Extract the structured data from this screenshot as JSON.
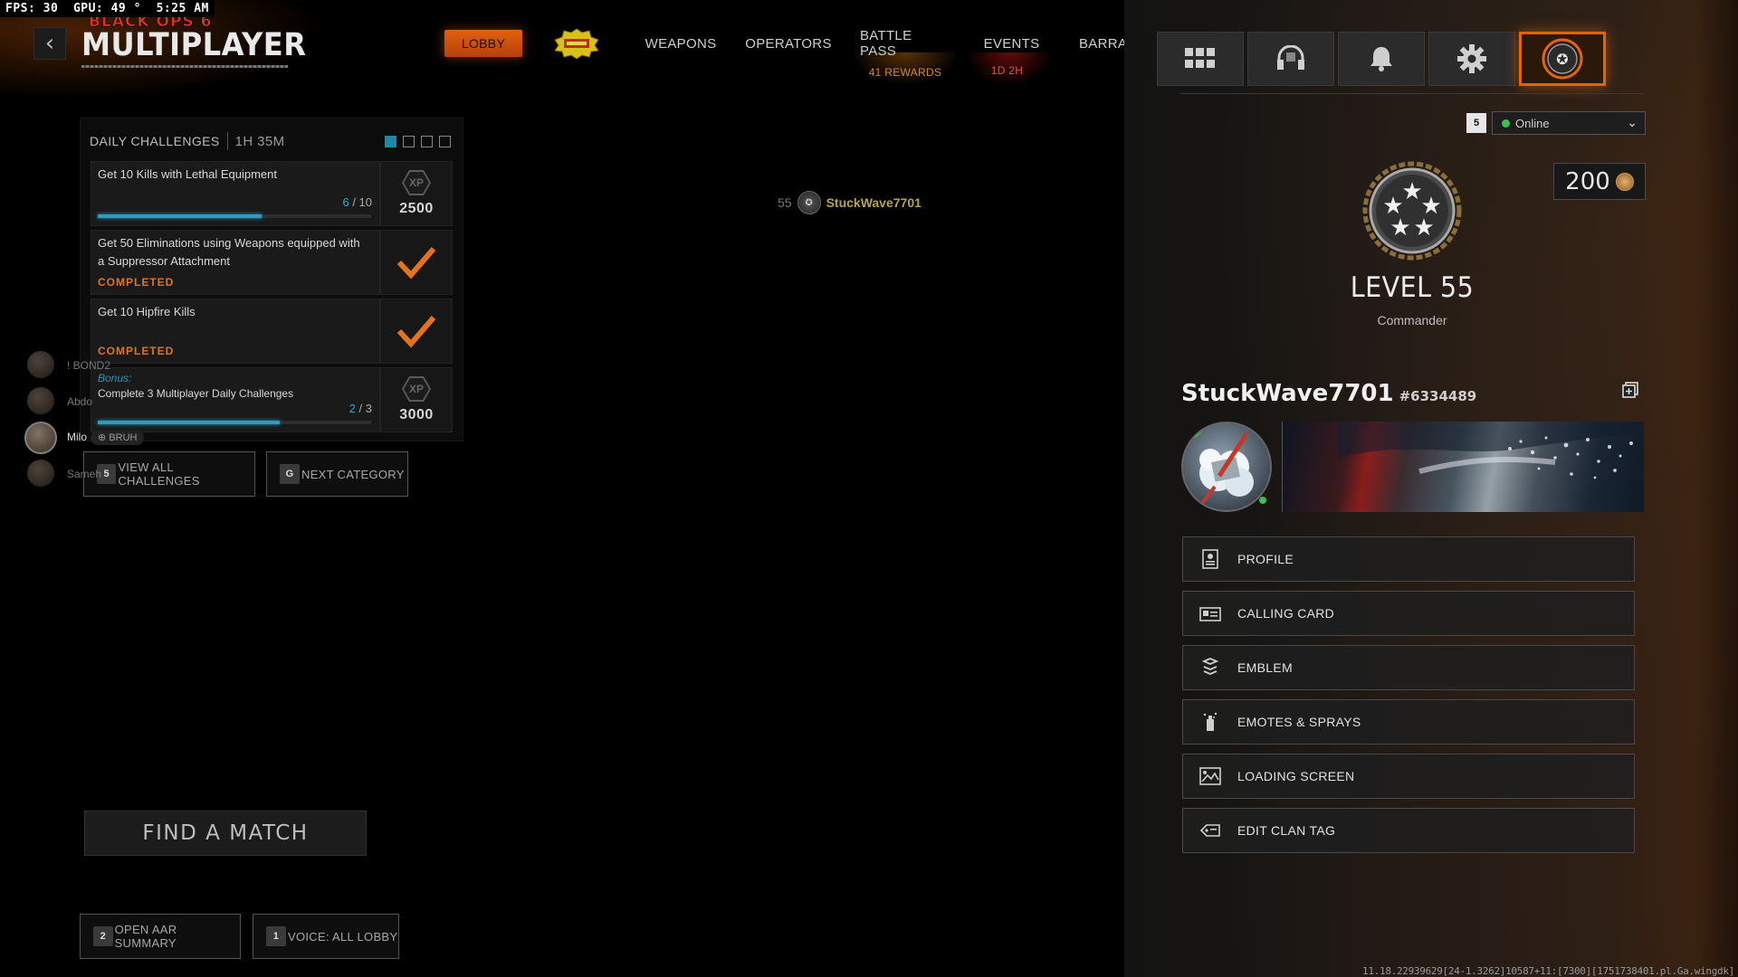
{
  "hud": {
    "fps_label": "FPS:",
    "fps_value": "30",
    "gpu_label": "GPU:",
    "gpu_value": "49 °",
    "clock": "5:25 AM"
  },
  "brand": {
    "top": "BLACK OPS 6",
    "main": "MULTIPLAYER"
  },
  "nav": {
    "lobby": "LOBBY",
    "weapons": "WEAPONS",
    "operators": "OPERATORS",
    "battle_pass": "BATTLE PASS",
    "battle_pass_sub": "41 REWARDS",
    "events": "EVENTS",
    "events_sub": "1D 2H",
    "barracks": "BARRAC"
  },
  "challenges": {
    "header": "DAILY CHALLENGES",
    "timer": "1H 35M",
    "items": [
      {
        "title": "Get 10 Kills with Lethal Equipment",
        "progress_current": "6",
        "progress_total": "/ 10",
        "progress_fraction": 0.6,
        "xp_label": "XP",
        "xp": "2500"
      },
      {
        "title": "Get 50 Eliminations using Weapons equipped with a Suppressor Attachment",
        "status": "COMPLETED"
      },
      {
        "title": "Get 10 Hipfire Kills",
        "status": "COMPLETED"
      }
    ],
    "bonus": {
      "label": "Bonus:",
      "title": "Complete 3 Multiplayer Daily Challenges",
      "progress_current": "2",
      "progress_total": "/ 3",
      "progress_fraction": 0.6667,
      "xp_label": "XP",
      "xp": "3000"
    },
    "view_all": {
      "key": "5",
      "label": "VIEW ALL CHALLENGES"
    },
    "next_category": {
      "key": "G",
      "label": "NEXT CATEGORY"
    }
  },
  "party": [
    {
      "name": "! BOND2",
      "tag": ""
    },
    {
      "name": "Abdo",
      "tag": ""
    },
    {
      "name": "Milo",
      "tag": "BRUH"
    },
    {
      "name": "Sameh",
      "tag": ""
    }
  ],
  "center_player": {
    "level": "55",
    "name": "StuckWave7701"
  },
  "actions": {
    "find_match": "FIND A MATCH",
    "aar": {
      "key": "2",
      "label": "OPEN AAR SUMMARY"
    },
    "voice": {
      "key": "1",
      "label": "VOICE: ALL LOBBY"
    }
  },
  "profile": {
    "status_key": "5",
    "status": "Online",
    "currency": "200",
    "level": "LEVEL 55",
    "rank": "Commander",
    "gamertag": "StuckWave7701",
    "gamertag_id": "#6334489",
    "menu": [
      {
        "icon": "profile-icon",
        "label": "PROFILE"
      },
      {
        "icon": "calling-card-icon",
        "label": "CALLING CARD"
      },
      {
        "icon": "emblem-icon",
        "label": "EMBLEM"
      },
      {
        "icon": "emotes-sprays-icon",
        "label": "EMOTES & SPRAYS"
      },
      {
        "icon": "loading-screen-icon",
        "label": "LOADING SCREEN"
      },
      {
        "icon": "clan-tag-icon",
        "label": "EDIT CLAN TAG"
      }
    ]
  },
  "top_icons": [
    "apps-grid-icon",
    "headset-icon",
    "notifications-bell-icon",
    "settings-gear-icon",
    "player-rank-icon"
  ],
  "colors": {
    "accent_orange": "#e0650f",
    "progress_blue": "#2d9cc0",
    "completed_orange": "#e3731e",
    "online_green": "#3fbf4f",
    "player_gold": "#b9a34a"
  },
  "build_info": "11.18.22939629[24-1.3262]10587+11:[7300][1751738401.pl.Ga.wingdk]"
}
